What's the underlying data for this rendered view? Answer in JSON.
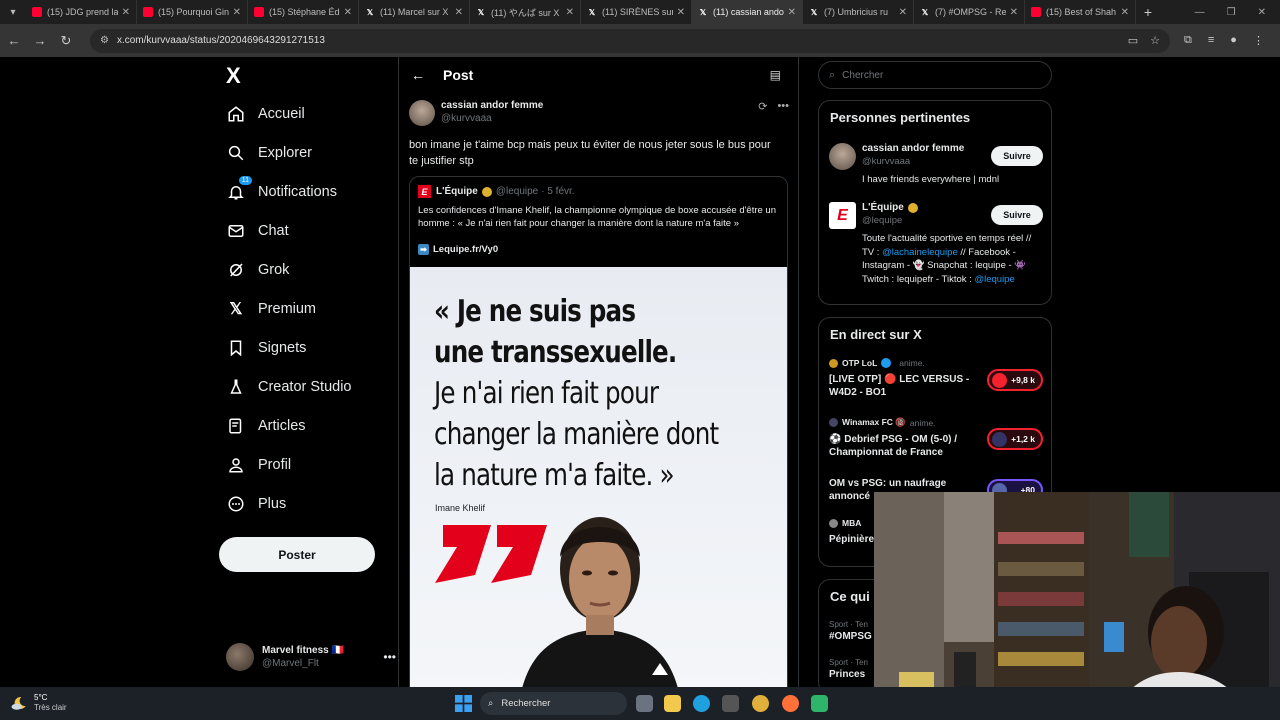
{
  "browser": {
    "tabs": [
      {
        "label": "(15) JDG prend la",
        "kind": "yt",
        "active": false
      },
      {
        "label": "(15) Pourquoi Gin",
        "kind": "yt",
        "active": false
      },
      {
        "label": "(15) Stéphane Édo",
        "kind": "yt",
        "active": false
      },
      {
        "label": "(11) Marcel sur X",
        "kind": "x",
        "active": false
      },
      {
        "label": "(11) やんば sur X",
        "kind": "x",
        "active": false
      },
      {
        "label": "(11) SIRÈNES sur",
        "kind": "x",
        "active": false
      },
      {
        "label": "(11) cassian ando",
        "kind": "x",
        "active": true
      },
      {
        "label": "(7) Umbricius ru",
        "kind": "x",
        "active": false
      },
      {
        "label": "(7) #OMPSG - Re",
        "kind": "x",
        "active": false
      },
      {
        "label": "(15) Best of Shah",
        "kind": "yt",
        "active": false
      }
    ],
    "url": "x.com/kurvvaaa/status/2020469643291271513"
  },
  "nav": {
    "logo": "X",
    "items": [
      {
        "label": "Accueil",
        "icon": "home-icon"
      },
      {
        "label": "Explorer",
        "icon": "search-icon"
      },
      {
        "label": "Notifications",
        "icon": "bell-icon",
        "badge": "11"
      },
      {
        "label": "Chat",
        "icon": "mail-icon"
      },
      {
        "label": "Grok",
        "icon": "grok-icon"
      },
      {
        "label": "Premium",
        "icon": "x-premium-icon"
      },
      {
        "label": "Signets",
        "icon": "bookmark-icon"
      },
      {
        "label": "Creator Studio",
        "icon": "flask-icon"
      },
      {
        "label": "Articles",
        "icon": "article-icon"
      },
      {
        "label": "Profil",
        "icon": "person-icon"
      },
      {
        "label": "Plus",
        "icon": "more-circle-icon"
      }
    ],
    "post_button": "Poster",
    "account": {
      "name": "Marvel fitness 🇫🇷",
      "handle": "@Marvel_Flt"
    }
  },
  "main": {
    "title": "Post",
    "tweet": {
      "name": "cassian andor femme",
      "handle": "@kurvvaaa",
      "text": "bon imane je t'aime bcp mais peux tu éviter de nous jeter sous le bus pour te justifier stp"
    },
    "quote": {
      "name": "L'Équipe",
      "handle": "@lequipe",
      "date": "· 5 févr.",
      "text": "Les confidences d'Imane Khelif, la championne olympique de boxe accusée d'être un homme : « Je n'ai rien fait pour changer la manière dont la nature m'a faite »",
      "link": "Lequipe.fr/Vy0",
      "image": {
        "line1": "« Je ne suis pas",
        "line2": "une transsexuelle.",
        "line3": "Je n'ai rien fait pour",
        "line4": "changer la manière dont",
        "line5": "la nature m'a faite. »",
        "author": "Imane Khelif"
      }
    }
  },
  "right": {
    "search_placeholder": "Chercher",
    "relevant": {
      "title": "Personnes pertinentes",
      "people": [
        {
          "name": "cassian andor femme",
          "handle": "@kurvvaaa",
          "bio": "I have friends everywhere | mdnl",
          "follow": "Suivre"
        },
        {
          "name": "L'Équipe",
          "handle": "@lequipe",
          "bio_1": "Toute l'actualité sportive en temps réel // TV : ",
          "bio_link1": "@lachainelequipe",
          "bio_2": " // Facebook - Instagram - 👻 Snapchat : lequipe - 👾 Twitch : lequipefr - Tiktok : ",
          "bio_link2": "@lequipe",
          "follow": "Suivre"
        }
      ]
    },
    "live": {
      "title": "En direct sur X",
      "items": [
        {
          "source": "OTP LoL",
          "tag": "anime.",
          "title": "[LIVE OTP] 🔴 LEC VERSUS - W4D2 - BO1",
          "count": "+9,8 k"
        },
        {
          "source": "Winamax FC 🔞",
          "tag": "anime.",
          "title": "⚽ Debrief PSG - OM (5-0) / Championnat de France",
          "count": "+1,2 k"
        },
        {
          "source": "",
          "tag": "",
          "title": "OM vs PSG: un naufrage annoncé",
          "count": "+80"
        },
        {
          "source": "MBA",
          "tag": "",
          "title": "Pépinière",
          "count": ""
        }
      ]
    },
    "trends": {
      "title": "Ce qui",
      "items": [
        {
          "sub": "Sport · Ten",
          "tag": "#OMPSG"
        },
        {
          "sub": "Sport · Ten",
          "tag": "Princes"
        }
      ]
    }
  },
  "taskbar": {
    "temp": "5°C",
    "condition": "Très clair",
    "search": "Rechercher"
  }
}
